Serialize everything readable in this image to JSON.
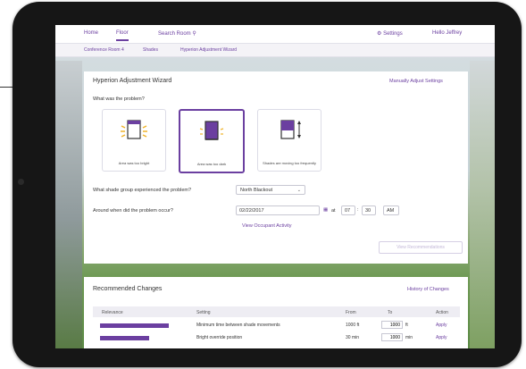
{
  "nav": {
    "home": "Home",
    "floor": "Floor",
    "search": "Search Room",
    "settings": "Settings",
    "user": "Hello Jeffrey"
  },
  "breadcrumb": [
    "Conference Room 4",
    "Shades",
    "Hyperion Adjustment Wizard"
  ],
  "wizard": {
    "title": "Hyperion Adjustment Wizard",
    "manual_link": "Manually Adjust Settings",
    "question": "What was the problem?",
    "options": [
      "Area was too bright",
      "Area was too dark",
      "Shades are moving too frequently"
    ],
    "group_label": "What shade group experienced the problem?",
    "group_value": "North Blackout",
    "when_label": "Around when did the problem occur?",
    "date": "02/22/2017",
    "at": "at",
    "hour": "07",
    "minute": "30",
    "ampm": "AM",
    "occupant_link": "View Occupant Activity",
    "recommend_button": "View Recommendations"
  },
  "changes": {
    "title": "Recommended Changes",
    "history_link": "History of Changes",
    "columns": [
      "Relevance",
      "Setting",
      "From",
      "To",
      "Action"
    ],
    "rows": [
      {
        "relevance": 0.9,
        "setting": "Minimum time between shade movements",
        "from": "1000 ft",
        "to": "1000",
        "unit": "ft",
        "action": "Apply"
      },
      {
        "relevance": 0.65,
        "setting": "Bright override position",
        "from": "30 min",
        "to": "1000",
        "unit": "min",
        "action": "Apply"
      }
    ]
  },
  "colors": {
    "accent": "#6b3fa0"
  }
}
